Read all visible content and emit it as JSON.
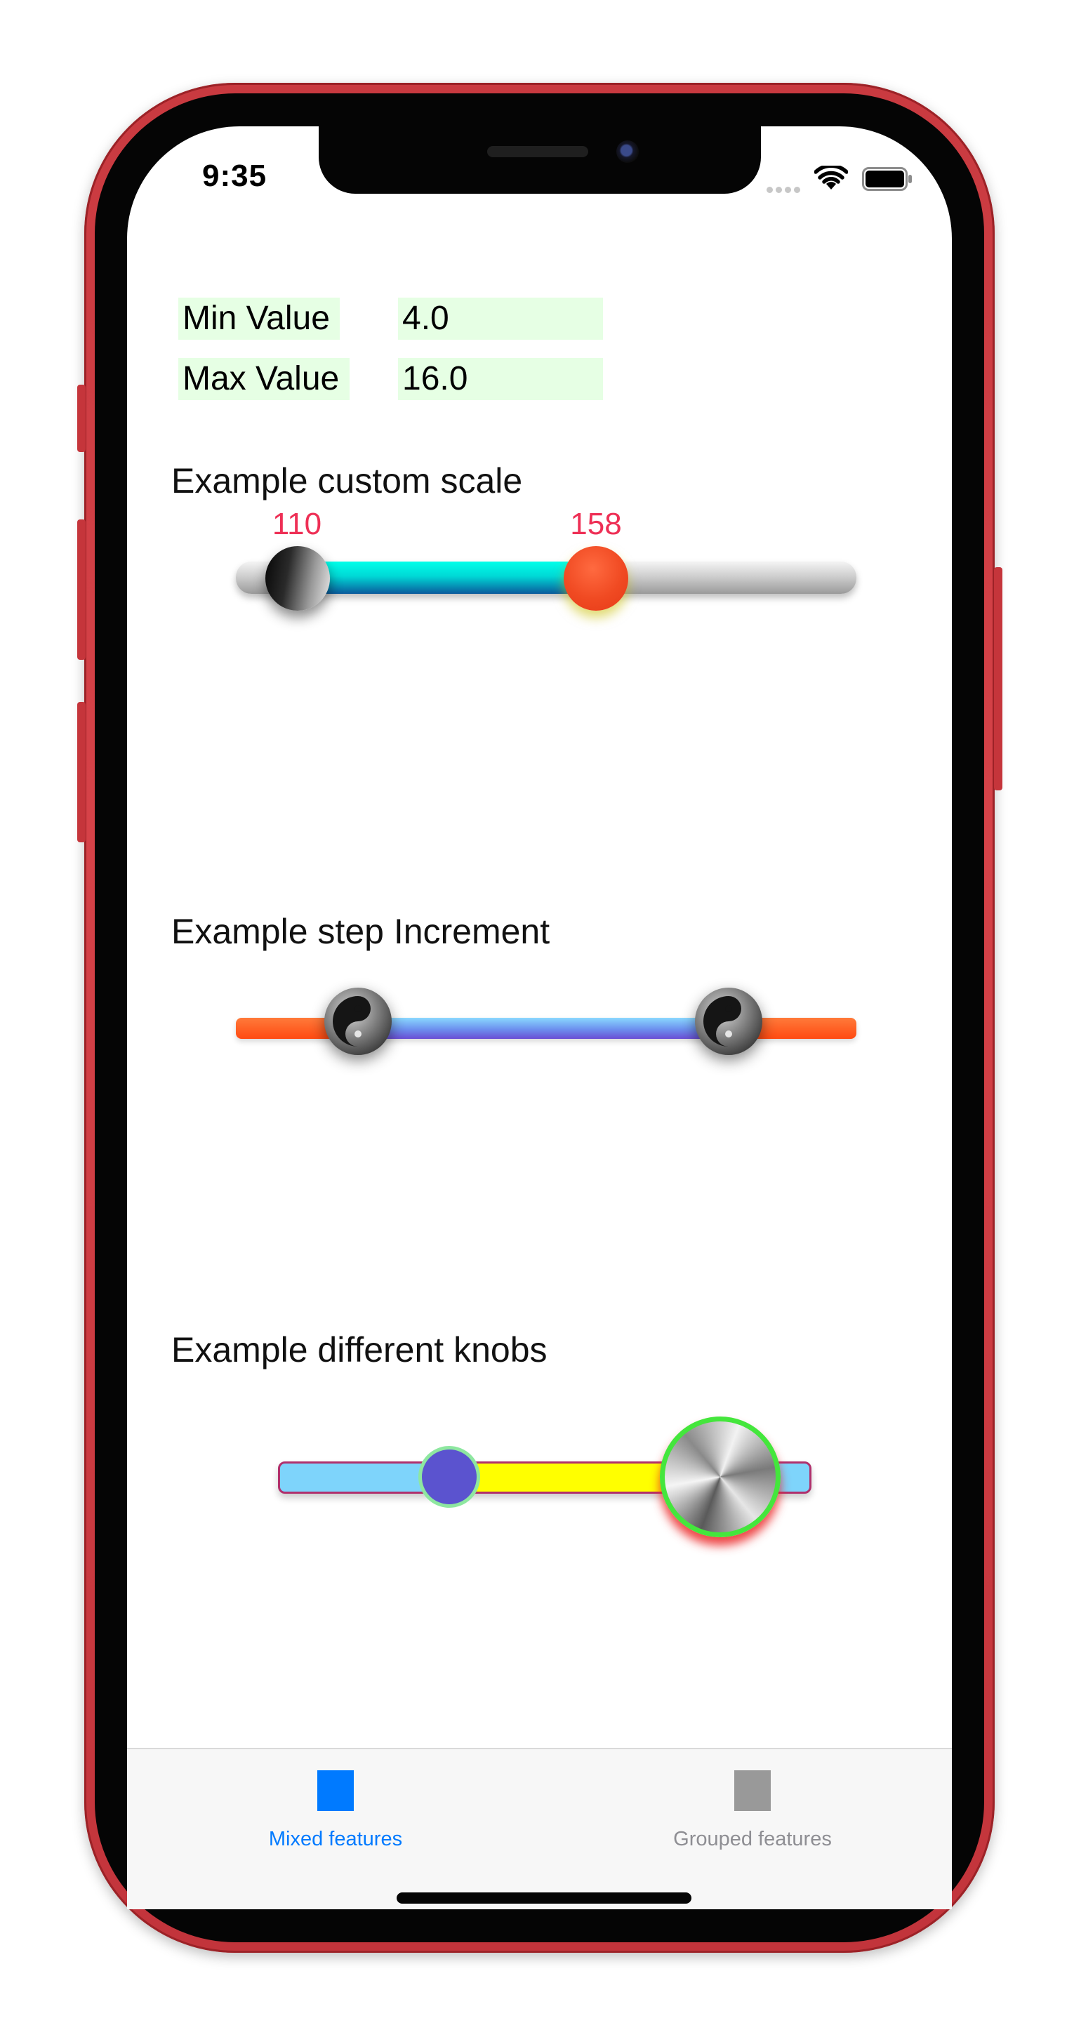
{
  "status_bar": {
    "time": "9:35",
    "icons": [
      "cellular-dots-icon",
      "wifi-icon",
      "battery-icon"
    ]
  },
  "fields": {
    "min_label": "Min Value",
    "min_value": "4.0",
    "max_label": "Max Value",
    "max_value": "16.0"
  },
  "sections": {
    "custom_scale": {
      "title": "Example custom scale",
      "lower_label": "110",
      "upper_label": "158"
    },
    "step_increment": {
      "title": "Example step Increment"
    },
    "different_knobs": {
      "title": "Example different knobs"
    }
  },
  "tabbar": {
    "tabs": [
      {
        "label": "Mixed features",
        "selected": true
      },
      {
        "label": "Grouped features",
        "selected": false
      }
    ]
  },
  "colors": {
    "accent": "#007aff",
    "label_red": "#ee2f55",
    "field_bg": "#e6ffe4",
    "frame": "#d03c42"
  }
}
